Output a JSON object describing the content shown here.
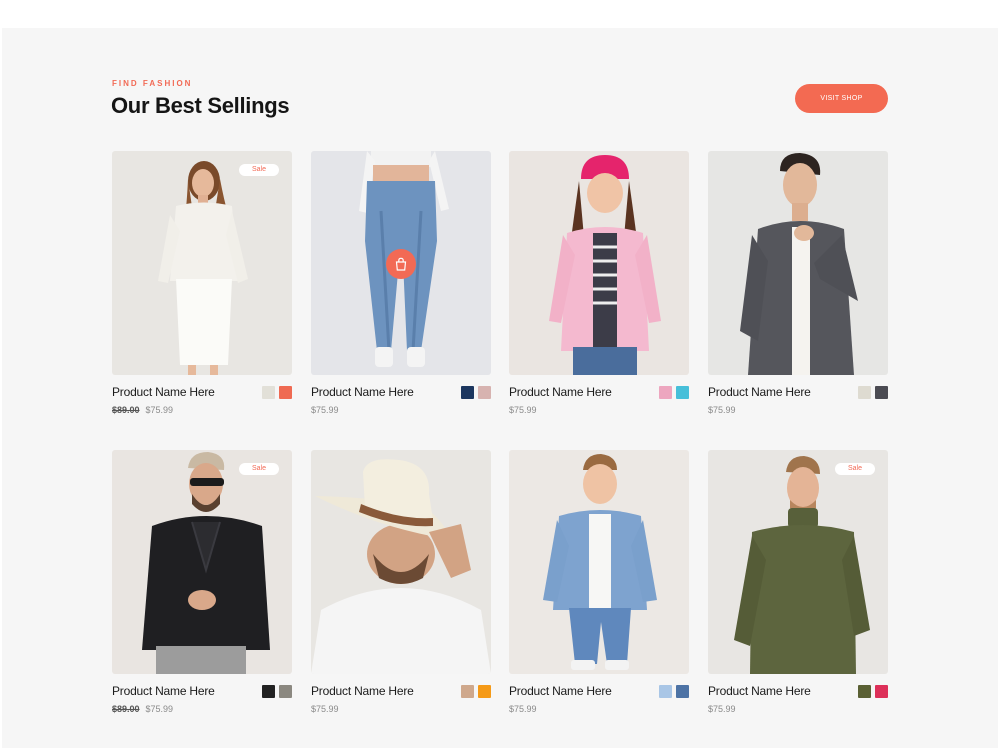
{
  "header": {
    "eyebrow": "FIND FASHION",
    "title": "Our Best Sellings",
    "button_label": "VISIT SHOP"
  },
  "theme": {
    "accent": "#f26a55",
    "panel": "#f6f6f6"
  },
  "products": [
    {
      "name": "Product Name Here",
      "old_price": "$89.00",
      "price": "$75.99",
      "badge": "Sale",
      "image": "woman-white-outfit",
      "swatches": [
        "#e2e0d8",
        "#ef6a52"
      ]
    },
    {
      "name": "Product Name Here",
      "old_price": "",
      "price": "$75.99",
      "badge": "",
      "image": "woman-jeans",
      "cart_icon": "shopping-bag-icon",
      "swatches": [
        "#1c365f",
        "#d7b3b0"
      ]
    },
    {
      "name": "Product Name Here",
      "old_price": "",
      "price": "$75.99",
      "badge": "",
      "image": "girl-pink-jacket",
      "swatches": [
        "#eda6bf",
        "#47bfd9"
      ]
    },
    {
      "name": "Product Name Here",
      "old_price": "",
      "price": "$75.99",
      "badge": "",
      "image": "man-grey-cardigan",
      "swatches": [
        "#dedbd1",
        "#4b4b52"
      ]
    },
    {
      "name": "Product Name Here",
      "old_price": "$89.00",
      "price": "$75.99",
      "badge": "Sale",
      "image": "man-leather-jacket",
      "swatches": [
        "#222222",
        "#8b8880"
      ]
    },
    {
      "name": "Product Name Here",
      "old_price": "",
      "price": "$75.99",
      "badge": "",
      "image": "man-cowboy-hat",
      "swatches": [
        "#cfa88c",
        "#f59a17"
      ]
    },
    {
      "name": "Product Name Here",
      "old_price": "",
      "price": "$75.99",
      "badge": "",
      "image": "boy-denim-jacket",
      "swatches": [
        "#a9c6e6",
        "#4d73a5"
      ]
    },
    {
      "name": "Product Name Here",
      "old_price": "",
      "price": "$75.99",
      "badge": "Sale",
      "image": "man-olive-sweater",
      "swatches": [
        "#5a6034",
        "#dd3059"
      ]
    }
  ]
}
